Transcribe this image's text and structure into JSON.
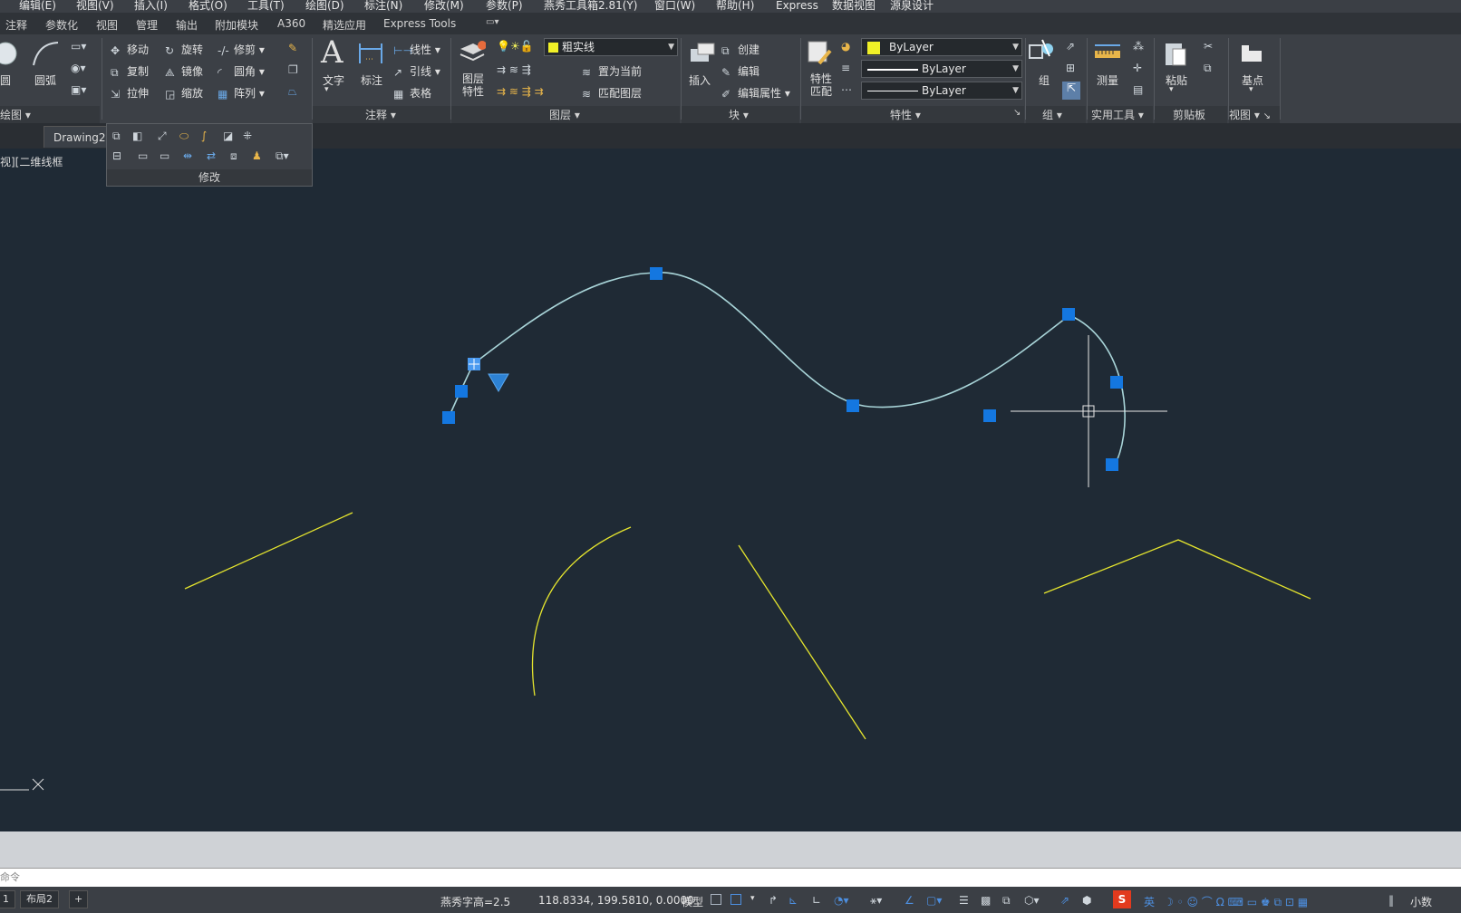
{
  "menu": [
    "编辑(E)",
    "视图(V)",
    "插入(I)",
    "格式(O)",
    "工具(T)",
    "绘图(D)",
    "标注(N)",
    "修改(M)",
    "参数(P)",
    "燕秀工具箱2.81(Y)",
    "窗口(W)",
    "帮助(H)",
    "Express",
    "数据视图",
    "源泉设计"
  ],
  "ribbon_tabs": [
    "注释",
    "参数化",
    "视图",
    "管理",
    "输出",
    "附加模块",
    "A360",
    "精选应用",
    "Express Tools"
  ],
  "ribbon": {
    "draw": {
      "circle": "圆",
      "arc": "圆弧",
      "title": "绘图"
    },
    "modify": {
      "move": "移动",
      "rotate": "旋转",
      "trim": "修剪",
      "copy": "复制",
      "mirror": "镜像",
      "fillet": "圆角",
      "stretch": "拉伸",
      "scale": "缩放",
      "array": "阵列",
      "title": "修改"
    },
    "annotation": {
      "text": "文字",
      "dimension": "标注",
      "linear": "线性",
      "leader": "引线",
      "table": "表格",
      "title": "注释"
    },
    "layers": {
      "layer_properties": "图层\n特性",
      "current_layer": "粗实线",
      "make_current": "置为当前",
      "match_layer": "匹配图层",
      "title": "图层"
    },
    "block": {
      "insert": "插入",
      "create": "创建",
      "edit": "编辑",
      "edit_attributes": "编辑属性",
      "title": "块"
    },
    "properties": {
      "match": "特性\n匹配",
      "color": "ByLayer",
      "linetype": "ByLayer",
      "lineweight": "ByLayer",
      "title": "特性"
    },
    "group": {
      "group": "组",
      "title": "组"
    },
    "utilities": {
      "measure": "测量",
      "title": "实用工具"
    },
    "clipboard": {
      "paste": "粘贴",
      "title": "剪贴板"
    },
    "view": {
      "base": "基点",
      "title": "视图"
    }
  },
  "doc_tab": "Drawing2",
  "viewport_label": "视][二维线框",
  "command_prompt": "命令",
  "layout_tabs": [
    "1",
    "布局2",
    "+"
  ],
  "status": {
    "text_height": "燕秀字高=2.5",
    "coords": "118.8334, 199.5810, 0.0000",
    "model": "模型",
    "ime_lang": "英",
    "decimal": "小数"
  },
  "colors": {
    "canvas": "#1f2a35",
    "spline": "#a8d4d8",
    "yellow": "#e5e52e",
    "grip": "#1477e0"
  }
}
